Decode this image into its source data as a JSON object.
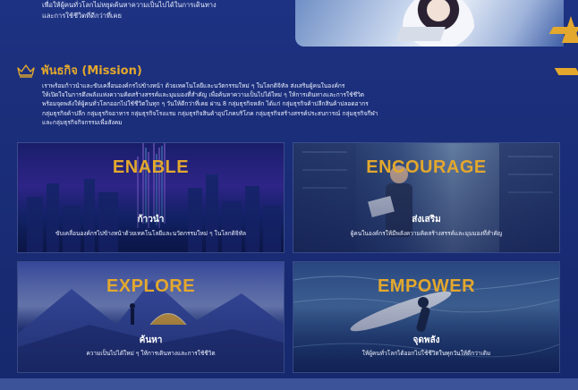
{
  "intro": {
    "line1": "เพื่อให้ผู้คนทั่วโลกไม่หยุดค้นหาความเป็นไปได้ในการเดินทาง",
    "line2": "และการใช้ชีวิตที่ดีกว่าที่เคย"
  },
  "mission": {
    "title": "พันธกิจ (Mission)",
    "body_lines": [
      "เราพร้อมก้าวนำและขับเคลื่อนองค์กรไปข้างหน้า ด้วยเทคโนโลยีและนวัตกรรมใหม่ ๆ ในโลกดิจิทัล ส่งเสริมผู้คนในองค์กร",
      "ให้เปิดใจในการดึงพลังแห่งความคิดสร้างสรรค์และมุมมองที่สำคัญ เพื่อค้นหาความเป็นไปได้ใหม่ ๆ ให้การเดินทางและการใช้ชีวิต",
      "พร้อมจุดพลังให้ผู้คนทั่วโลกออกไปใช้ชีวิตในทุก ๆ วันให้ดีกว่าที่เคย ผ่าน 8 กลุ่มธุรกิจหลัก ได้แก่ กลุ่มธุรกิจค้าปลีกสินค้าปลอดอากร",
      "กลุ่มธุรกิจค้าปลีก กลุ่มธุรกิจอาหาร กลุ่มธุรกิจโรงแรม กลุ่มธุรกิจสินค้าอุปโภคบริโภค กลุ่มธุรกิจสร้างสรรค์ประสบการณ์ กลุ่มธุรกิจกีฬา",
      "และกลุ่มธุรกิจกิจกรรมเพื่อสังคม"
    ]
  },
  "cards": [
    {
      "word": "ENABLE",
      "thai": "ก้าวนำ",
      "desc": "ขับเคลื่อนองค์กรไปข้างหน้าด้วยเทคโนโลยีและนวัตกรรมใหม่ ๆ ในโลกดิจิทัล"
    },
    {
      "word": "ENCOURAGE",
      "thai": "ส่งเสริม",
      "desc": "ผู้คนในองค์กรให้มีพลังความคิดสร้างสรรค์และมุมมองที่สำคัญ"
    },
    {
      "word": "EXPLORE",
      "thai": "ค้นหา",
      "desc": "ความเป็นไปได้ใหม่ ๆ ให้การเดินทางและการใช้ชีวิต"
    },
    {
      "word": "EMPOWER",
      "thai": "จุดพลัง",
      "desc": "ให้ผู้คนทั่วโลกได้ออกไปใช้ชีวิตในทุกวันให้ดีกว่าเดิม"
    }
  ],
  "colors": {
    "accent": "#e3a82d",
    "background": "#1c2f7a"
  },
  "icons": {
    "mission": "crown-icon"
  }
}
